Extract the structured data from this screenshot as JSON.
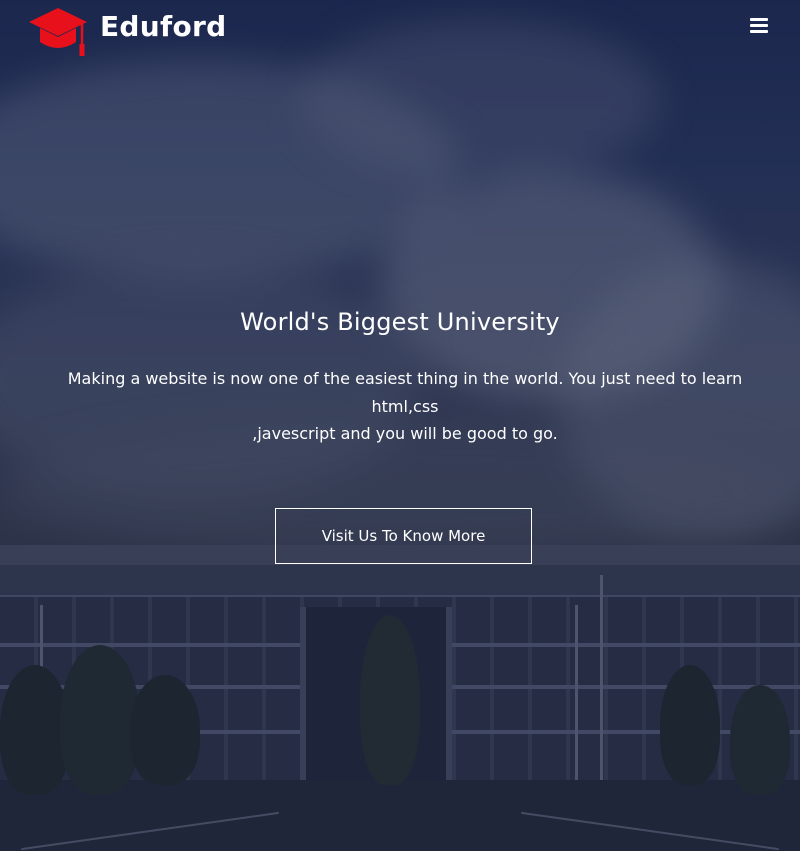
{
  "header": {
    "brand": "Eduford",
    "logo_icon": "graduation-cap-icon",
    "menu_icon": "hamburger-menu-icon",
    "logo_color": "#e8111b"
  },
  "hero": {
    "title": "World's Biggest University",
    "description_lines": [
      "Making a website is now one of the easiest thing in the world. You just need to learn",
      "html,css",
      ",javescript and you will be good to go."
    ],
    "cta_label": "Visit Us To Know More"
  }
}
